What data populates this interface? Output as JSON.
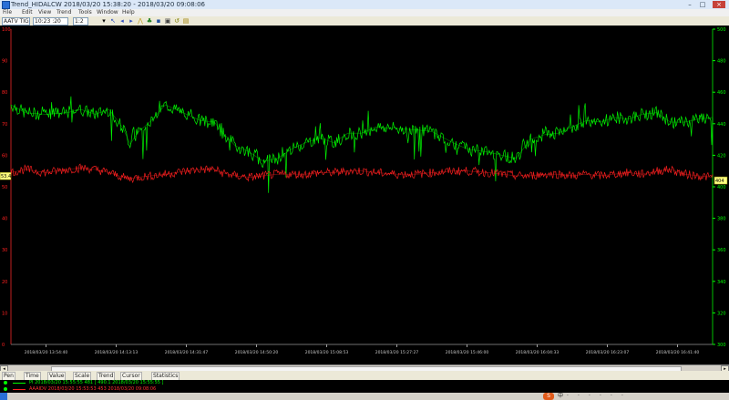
{
  "window": {
    "title": "Trend_HIDALCW  2018/03/20 15:38:20 - 2018/03/20 09:08:06",
    "minimize": "–",
    "maximize": "□",
    "close": "×"
  },
  "menu": [
    "File",
    "Edit",
    "View",
    "Trend",
    "Tools",
    "Window",
    "Help"
  ],
  "toolbar": {
    "tag_field": "AATV TIG",
    "interval_field": "10:23 :20",
    "extra_field": "1:2"
  },
  "tabs": [
    "Pen",
    "Time",
    "Value",
    "Scale",
    "Trend",
    "Cursor",
    "Statistics"
  ],
  "legend": [
    {
      "text": "PI 2018/03/20 15:55:55 481 [ 490.1  2018/03/20 15:55:55 ]",
      "color": "#00ff00"
    },
    {
      "text": "AAAIDV 2018/03/20 15:53:53  453  2018/03/20 09:08:06",
      "color": "#ff2020"
    }
  ],
  "tray": {
    "ime": "S",
    "items": [
      "中",
      "·",
      "·",
      "·",
      "·",
      "·",
      "·"
    ]
  },
  "chart_data": {
    "type": "line",
    "title": "",
    "x_ticks": [
      "2018/03/20 13:54:40",
      "2018/03/20 14:13:13",
      "2018/03/20 14:31:47",
      "2018/03/20 14:50:20",
      "2018/03/20 15:08:53",
      "2018/03/20 15:27:27",
      "2018/03/20 15:46:00",
      "2018/03/20 16:04:33",
      "2018/03/20 16:23:07",
      "2018/03/20 16:41:40"
    ],
    "left_axis": {
      "ticks": [
        100,
        90,
        80,
        70,
        60,
        50,
        40,
        30,
        20,
        10,
        0
      ],
      "color": "#ff2020",
      "ylim": [
        0,
        100
      ]
    },
    "right_axis": {
      "ticks": [
        500,
        480,
        460,
        440,
        420,
        400,
        380,
        360,
        340,
        320,
        300
      ],
      "color": "#00ff00",
      "ylim": [
        300,
        500
      ]
    },
    "current_left_value": "53.4",
    "current_right_value": "404",
    "series": [
      {
        "name": "PI",
        "color": "#00ff00",
        "axis": "right",
        "x": [
          0,
          2,
          5,
          8,
          10,
          12,
          14,
          16,
          17,
          18,
          20,
          22,
          25,
          27,
          29,
          30,
          32,
          34,
          36,
          38,
          40,
          42,
          44,
          46,
          48,
          50,
          52,
          55,
          58,
          60,
          63,
          65,
          68,
          70,
          72,
          74,
          76,
          78,
          80,
          82,
          84,
          86,
          88,
          90,
          92,
          94,
          96,
          98,
          100
        ],
        "values": [
          452,
          447,
          446,
          447,
          449,
          446,
          449,
          437,
          427,
          434,
          442,
          452,
          446,
          442,
          441,
          435,
          426,
          422,
          416,
          418,
          424,
          428,
          431,
          428,
          434,
          434,
          438,
          437,
          436,
          435,
          428,
          424,
          422,
          420,
          418,
          430,
          433,
          434,
          438,
          442,
          441,
          444,
          443,
          446,
          447,
          441,
          441,
          443,
          444
        ]
      },
      {
        "name": "AAAIDV",
        "color": "#ff2020",
        "axis": "left",
        "x": [
          0,
          2,
          5,
          8,
          10,
          12,
          14,
          16,
          17,
          18,
          20,
          22,
          25,
          27,
          29,
          30,
          32,
          34,
          36,
          38,
          40,
          42,
          44,
          46,
          48,
          50,
          52,
          55,
          58,
          60,
          63,
          65,
          68,
          70,
          72,
          74,
          76,
          78,
          80,
          82,
          84,
          86,
          88,
          90,
          92,
          94,
          96,
          98,
          100
        ],
        "values": [
          54.5,
          55.5,
          54.5,
          55.5,
          56,
          55.5,
          54.5,
          53,
          52.5,
          53,
          53.5,
          54,
          55,
          55.5,
          55.5,
          54.5,
          53.5,
          53,
          53.5,
          54,
          54,
          54,
          54.5,
          54.5,
          55,
          55,
          54.5,
          54,
          54,
          54.5,
          55,
          55,
          54.5,
          54,
          53.5,
          53.5,
          54,
          54,
          53.5,
          54,
          53.5,
          54,
          54.5,
          54,
          55,
          55.5,
          54,
          53.5,
          53
        ]
      }
    ]
  }
}
